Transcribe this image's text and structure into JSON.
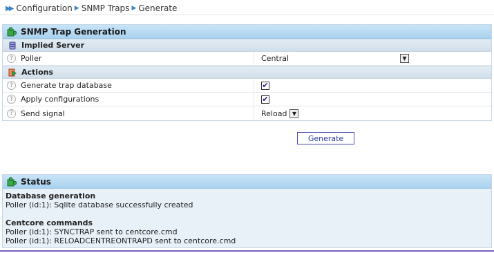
{
  "breadcrumb": {
    "items": [
      "Configuration",
      "SNMP Traps",
      "Generate"
    ]
  },
  "generation_panel": {
    "title": "SNMP Trap Generation",
    "implied_server": {
      "title": "Implied Server",
      "poller": {
        "label": "Poller",
        "value": "Central"
      }
    },
    "actions": {
      "title": "Actions",
      "generate_db": {
        "label": "Generate trap database",
        "checked": true
      },
      "apply_config": {
        "label": "Apply configurations",
        "checked": true
      },
      "send_signal": {
        "label": "Send signal",
        "value": "Reload"
      }
    }
  },
  "generate_button": {
    "label": "Generate"
  },
  "status_panel": {
    "title": "Status",
    "db_heading": "Database generation",
    "db_message": "Poller (id:1): Sqlite database successfully created",
    "centcore_heading": "Centcore commands",
    "centcore_lines": [
      "Poller (id:1): SYNCTRAP sent to centcore.cmd",
      "Poller (id:1): RELOADCENTREONTRAPD sent to centcore.cmd"
    ]
  },
  "colors": {
    "header_blue": "#a9d2ef",
    "link_blue": "#3b83c4",
    "button_text": "#2c3e9e",
    "status_bg": "#e8f1f8"
  }
}
